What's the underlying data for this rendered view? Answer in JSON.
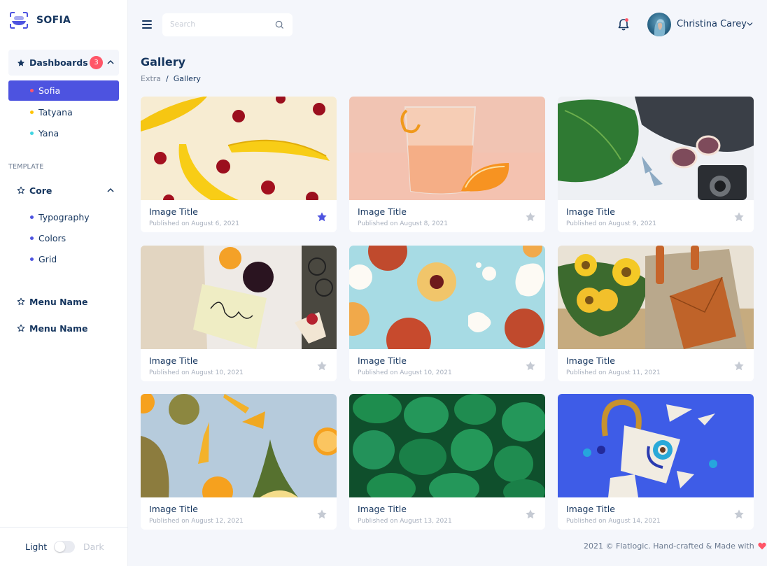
{
  "brand": {
    "name": "SOFIA"
  },
  "sidebar": {
    "dashboards": {
      "label": "Dashboards",
      "badge": "3",
      "expanded": true,
      "items": [
        {
          "label": "Sofia",
          "dot_color": "#ff5668",
          "active": true
        },
        {
          "label": "Tatyana",
          "dot_color": "#ffc405",
          "active": false
        },
        {
          "label": "Yana",
          "dot_color": "#41d5e2",
          "active": false
        }
      ]
    },
    "section_label": "TEMPLATE",
    "core": {
      "label": "Core",
      "expanded": true,
      "items": [
        {
          "label": "Typography",
          "dot_color": "#4d53e0"
        },
        {
          "label": "Colors",
          "dot_color": "#4d53e0"
        },
        {
          "label": "Grid",
          "dot_color": "#4d53e0"
        }
      ]
    },
    "menu_items": [
      {
        "label": "Menu Name"
      },
      {
        "label": "Menu Name"
      }
    ],
    "theme": {
      "light_label": "Light",
      "dark_label": "Dark",
      "dark_enabled": false
    }
  },
  "header": {
    "search": {
      "placeholder": "Search",
      "value": ""
    },
    "notifications": {
      "has_unread": true
    },
    "user": {
      "name": "Christina Carey"
    }
  },
  "page": {
    "title": "Gallery",
    "breadcrumb": [
      "Extra",
      "Gallery"
    ]
  },
  "gallery": [
    {
      "title": "Image Title",
      "date": "Published on August 6, 2021",
      "favorite": true,
      "image": "bananas-and-cherries"
    },
    {
      "title": "Image Title",
      "date": "Published on August 8, 2021",
      "favorite": false,
      "image": "orange-drink"
    },
    {
      "title": "Image Title",
      "date": "Published on August 9, 2021",
      "favorite": false,
      "image": "summer-accessories"
    },
    {
      "title": "Image Title",
      "date": "Published on August 10, 2021",
      "favorite": false,
      "image": "summer-note"
    },
    {
      "title": "Image Title",
      "date": "Published on August 10, 2021",
      "favorite": false,
      "image": "peaches"
    },
    {
      "title": "Image Title",
      "date": "Published on August 11, 2021",
      "favorite": false,
      "image": "sunflowers-bag"
    },
    {
      "title": "Image Title",
      "date": "Published on August 12, 2021",
      "favorite": false,
      "image": "tropical-fruits"
    },
    {
      "title": "Image Title",
      "date": "Published on August 13, 2021",
      "favorite": false,
      "image": "green-leaves"
    },
    {
      "title": "Image Title",
      "date": "Published on August 14, 2021",
      "favorite": false,
      "image": "broken-ceramic-lock"
    }
  ],
  "colors": {
    "accent": "#4d53e0",
    "star_active": "#4d53e0",
    "star_inactive": "#c5cad3",
    "badge": "#ff5668",
    "heart": "#ff5668"
  },
  "footer": {
    "text": "2021 © Flatlogic. Hand-crafted & Made with"
  }
}
